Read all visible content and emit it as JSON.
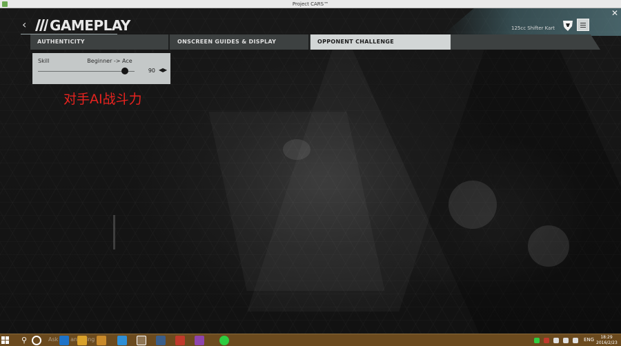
{
  "window": {
    "title": "Project CARS™"
  },
  "header": {
    "title": "GAMEPLAY",
    "vehicle": "125cc Shifter Kart"
  },
  "tabs": [
    {
      "label": "AUTHENTICITY",
      "active": false
    },
    {
      "label": "ONSCREEN GUIDES & DISPLAY",
      "active": false
    },
    {
      "label": "OPPONENT CHALLENGE",
      "active": true
    }
  ],
  "setting": {
    "label": "Skill",
    "range": "Beginner -> Ace",
    "value": "90",
    "value_fraction": 0.9
  },
  "annotation": "对手AI战斗力",
  "taskbar": {
    "hint": "Ask me anything",
    "language": "ENG",
    "time": "18:29",
    "date": "2016/2/23"
  },
  "colors": {
    "accent_teal": "#6aa0aa",
    "tab_active": "#d2d6d6",
    "annotation_red": "#e8231f",
    "taskbar": "#6b4a1e"
  },
  "icons": {
    "back": "chevron-left-icon",
    "logo": "project-cars-logo-icon",
    "team": "team-emblem-icon",
    "menu": "menu-icon",
    "close": "close-icon"
  }
}
